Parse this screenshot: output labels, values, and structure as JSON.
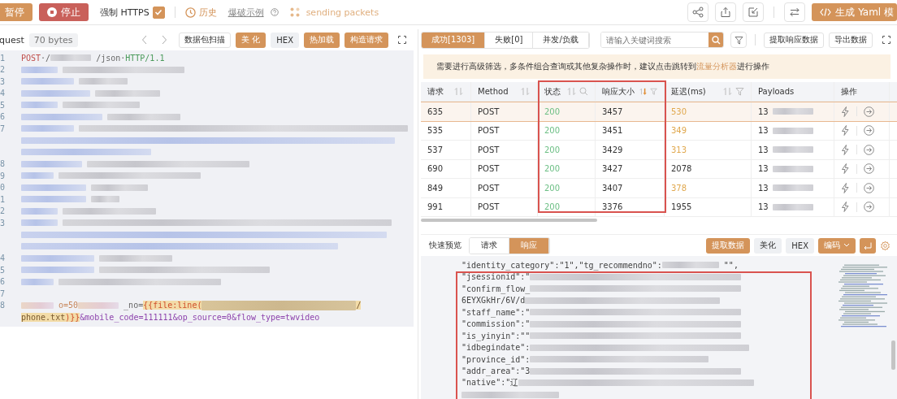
{
  "toolbar": {
    "pause_button": "暂停",
    "stop_button": "停止",
    "force_https": {
      "label": "强制 HTTPS",
      "checked": true
    },
    "history_link": "历史",
    "example_link": "爆破示例",
    "status_text": "sending packets",
    "yaml_button": "生成 Yaml 模"
  },
  "request_panel": {
    "title": "quest",
    "size_badge": "70 bytes",
    "buttons": [
      {
        "label": "数据包扫描",
        "selected": false
      },
      {
        "label": "美 化",
        "selected": true
      },
      {
        "label": "HEX",
        "selected": false
      },
      {
        "label": "热加载",
        "selected": true
      },
      {
        "label": "构造请求",
        "selected": true
      }
    ],
    "lines": [
      {
        "number": "1",
        "kind": "code",
        "segments": [
          {
            "kind": "method",
            "text": "POST"
          },
          {
            "kind": "plain",
            "text": "·/"
          },
          {
            "kind": "blur"
          },
          {
            "kind": "plain",
            "text": "/json·"
          },
          {
            "kind": "version",
            "text": "HTTP/1.1"
          }
        ]
      },
      {
        "number": "2",
        "kind": "redacted"
      },
      {
        "number": "3",
        "kind": "redacted"
      },
      {
        "number": "4",
        "kind": "redacted"
      },
      {
        "number": "5",
        "kind": "redacted"
      },
      {
        "number": "6",
        "kind": "redacted"
      },
      {
        "number": "7",
        "kind": "redacted"
      },
      {
        "kind": "redacted"
      },
      {
        "kind": "redacted"
      },
      {
        "number": "8",
        "kind": "redacted"
      },
      {
        "number": "9",
        "kind": "redacted"
      },
      {
        "number": "0",
        "kind": "redacted"
      },
      {
        "number": "1",
        "kind": "redacted"
      },
      {
        "number": "2",
        "kind": "redacted"
      },
      {
        "number": "3",
        "kind": "redacted"
      },
      {
        "kind": "redacted"
      },
      {
        "kind": "redacted"
      },
      {
        "number": "4",
        "kind": "redacted"
      },
      {
        "number": "5",
        "kind": "redacted"
      },
      {
        "number": "6",
        "kind": "redacted"
      },
      {
        "number": "7",
        "kind": "empty"
      },
      {
        "number": "8",
        "kind": "code",
        "segments": [
          {
            "kind": "blur"
          },
          {
            "kind": "value",
            "text": "o=50"
          },
          {
            "kind": "blur"
          },
          {
            "kind": "plain",
            "text": "_no="
          },
          {
            "kind": "template",
            "text": "{{file:line("
          },
          {
            "kind": "template-blur"
          },
          {
            "kind": "template-text",
            "text": "/"
          }
        ]
      },
      {
        "kind": "code",
        "segments": [
          {
            "kind": "template-text",
            "text": "phone.txt"
          },
          {
            "kind": "template",
            "text": ")}}"
          },
          {
            "kind": "param",
            "text": "&mobile_code=111111&op_source=0&flow_type=twvideo"
          }
        ]
      }
    ]
  },
  "results_panel": {
    "tabs": [
      {
        "label": "成功[1303]",
        "selected": true
      },
      {
        "label": "失败[0]",
        "selected": false
      },
      {
        "label": "并发/负载",
        "selected": false
      }
    ],
    "search": {
      "placeholder": "请输入关键词搜索"
    },
    "buttons": [
      "提取响应数据",
      "导出数据"
    ],
    "notice": {
      "text": "需要进行高级筛选，多条件组合查询或其他复杂操作时，建议点击跳转到",
      "link": "流量分析器",
      "suffix": "进行操作"
    },
    "table": {
      "highlight_box": true,
      "columns": [
        {
          "label": "请求",
          "sortable": true,
          "sorted": false,
          "searchable": false,
          "filterable": false
        },
        {
          "label": "Method",
          "sortable": true,
          "sorted": false,
          "searchable": false,
          "filterable": false
        },
        {
          "label": "状态",
          "sortable": true,
          "sorted": false,
          "searchable": true,
          "filterable": false
        },
        {
          "label": "响应大小",
          "sortable": true,
          "sorted": true,
          "searchable": false,
          "filterable": true
        },
        {
          "label": "延迟(ms)",
          "sortable": true,
          "sorted": false,
          "searchable": false,
          "filterable": true
        },
        {
          "label": "Payloads",
          "sortable": false,
          "sorted": false,
          "searchable": false,
          "filterable": false
        },
        {
          "label": "操作",
          "sortable": false,
          "sorted": false,
          "searchable": false,
          "filterable": false
        }
      ],
      "rows": [
        {
          "request": "635",
          "method": "POST",
          "status": "200",
          "size": "3457",
          "delay": "530",
          "color": "#e0a84e",
          "payload": "13",
          "selected": true
        },
        {
          "request": "535",
          "method": "POST",
          "status": "200",
          "size": "3451",
          "delay": "349",
          "color": "#e0a84e",
          "payload": "13",
          "selected": false
        },
        {
          "request": "537",
          "method": "POST",
          "status": "200",
          "size": "3429",
          "delay": "313",
          "color": "#e0a84e",
          "payload": "13",
          "selected": false
        },
        {
          "request": "690",
          "method": "POST",
          "status": "200",
          "size": "3427",
          "delay": "2078",
          "color": "#333333",
          "payload": "13",
          "selected": false
        },
        {
          "request": "849",
          "method": "POST",
          "status": "200",
          "size": "3407",
          "delay": "378",
          "color": "#e0a84e",
          "payload": "13",
          "selected": false
        },
        {
          "request": "991",
          "method": "POST",
          "status": "200",
          "size": "3376",
          "delay": "1955",
          "color": "#333333",
          "payload": "13",
          "selected": false
        }
      ]
    },
    "preview": {
      "label": "快速预览",
      "highlight_box": true,
      "tabs": [
        {
          "label": "请求",
          "selected": false
        },
        {
          "label": "响应",
          "selected": true
        }
      ],
      "buttons": [
        {
          "label": "提取数据",
          "selected": true
        },
        {
          "label": "美化",
          "selected": false
        },
        {
          "label": "HEX",
          "selected": false
        }
      ],
      "encode_button": "编码",
      "lines": [
        {
          "segments": [
            {
              "kind": "key",
              "text": "\"identity_category\":\"1\",\"tg_recommendno\":"
            },
            {
              "kind": "blur"
            },
            {
              "kind": "key",
              "text": "\"\","
            }
          ]
        },
        {
          "segments": [
            {
              "kind": "key",
              "text": "\"jsessionid\":\""
            },
            {
              "kind": "blur"
            }
          ]
        },
        {
          "segments": [
            {
              "kind": "key",
              "text": "\"confirm_flow_"
            },
            {
              "kind": "blur"
            }
          ]
        },
        {
          "segments": [
            {
              "kind": "key",
              "text": "6EYXGkHr/6V/d"
            },
            {
              "kind": "blur"
            }
          ]
        },
        {
          "segments": [
            {
              "kind": "key",
              "text": "\"staff_name\":\""
            },
            {
              "kind": "blur"
            }
          ]
        },
        {
          "segments": [
            {
              "kind": "key",
              "text": "\"commission\":\""
            },
            {
              "kind": "blur"
            }
          ]
        },
        {
          "segments": [
            {
              "kind": "key",
              "text": "\"is_yinyin\":\"\""
            },
            {
              "kind": "blur"
            }
          ]
        },
        {
          "segments": [
            {
              "kind": "key",
              "text": "\"idbegindate\":"
            },
            {
              "kind": "blur"
            }
          ]
        },
        {
          "segments": [
            {
              "kind": "key",
              "text": "\"province_id\":"
            },
            {
              "kind": "blur"
            }
          ]
        },
        {
          "segments": [
            {
              "kind": "key",
              "text": "\"addr_area\":\"3"
            },
            {
              "kind": "blur"
            }
          ]
        },
        {
          "segments": [
            {
              "kind": "key",
              "text": "\"native\":\"辽"
            },
            {
              "kind": "blur"
            }
          ]
        }
      ]
    }
  }
}
